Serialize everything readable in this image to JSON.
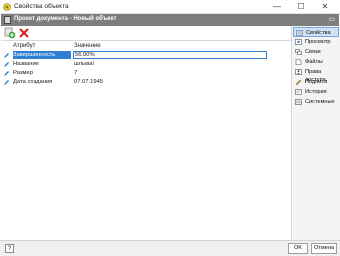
{
  "window": {
    "title": "Свойства объекта",
    "controls": {
      "minimize": "—",
      "maximize": "☐",
      "close": "✕"
    }
  },
  "doc_header": {
    "title": "Проект документа - Новый объект"
  },
  "toolbar": {
    "icons": [
      "add-green-icon",
      "delete-red-icon"
    ]
  },
  "grid": {
    "headers": {
      "attribute": "Атрибут",
      "value": "Значение"
    },
    "rows": [
      {
        "attribute": "Завершенность",
        "value": "56.00%",
        "selected": true
      },
      {
        "attribute": "Название",
        "value": "шлываl"
      },
      {
        "attribute": "Размер",
        "value": "7"
      },
      {
        "attribute": "Дата создания",
        "value": "07.07.1945"
      }
    ]
  },
  "sidebar": {
    "items": [
      {
        "label": "Свойства",
        "icon": "properties-icon",
        "active": true
      },
      {
        "label": "Просмотр",
        "icon": "preview-icon"
      },
      {
        "label": "Связи",
        "icon": "links-icon"
      },
      {
        "label": "Файлы",
        "icon": "files-icon"
      },
      {
        "label": "Права доступа",
        "icon": "access-rights-icon"
      },
      {
        "label": "Подписи",
        "icon": "signatures-icon"
      },
      {
        "label": "История",
        "icon": "history-icon"
      },
      {
        "label": "Системные",
        "icon": "system-icon"
      }
    ]
  },
  "footer": {
    "help": "?",
    "ok": "OK",
    "cancel": "Отмена"
  },
  "colors": {
    "header_bg": "#7d7d7d",
    "selection": "#2f7fd2",
    "add_green": "#3aa53a",
    "delete_red": "#d42020"
  }
}
